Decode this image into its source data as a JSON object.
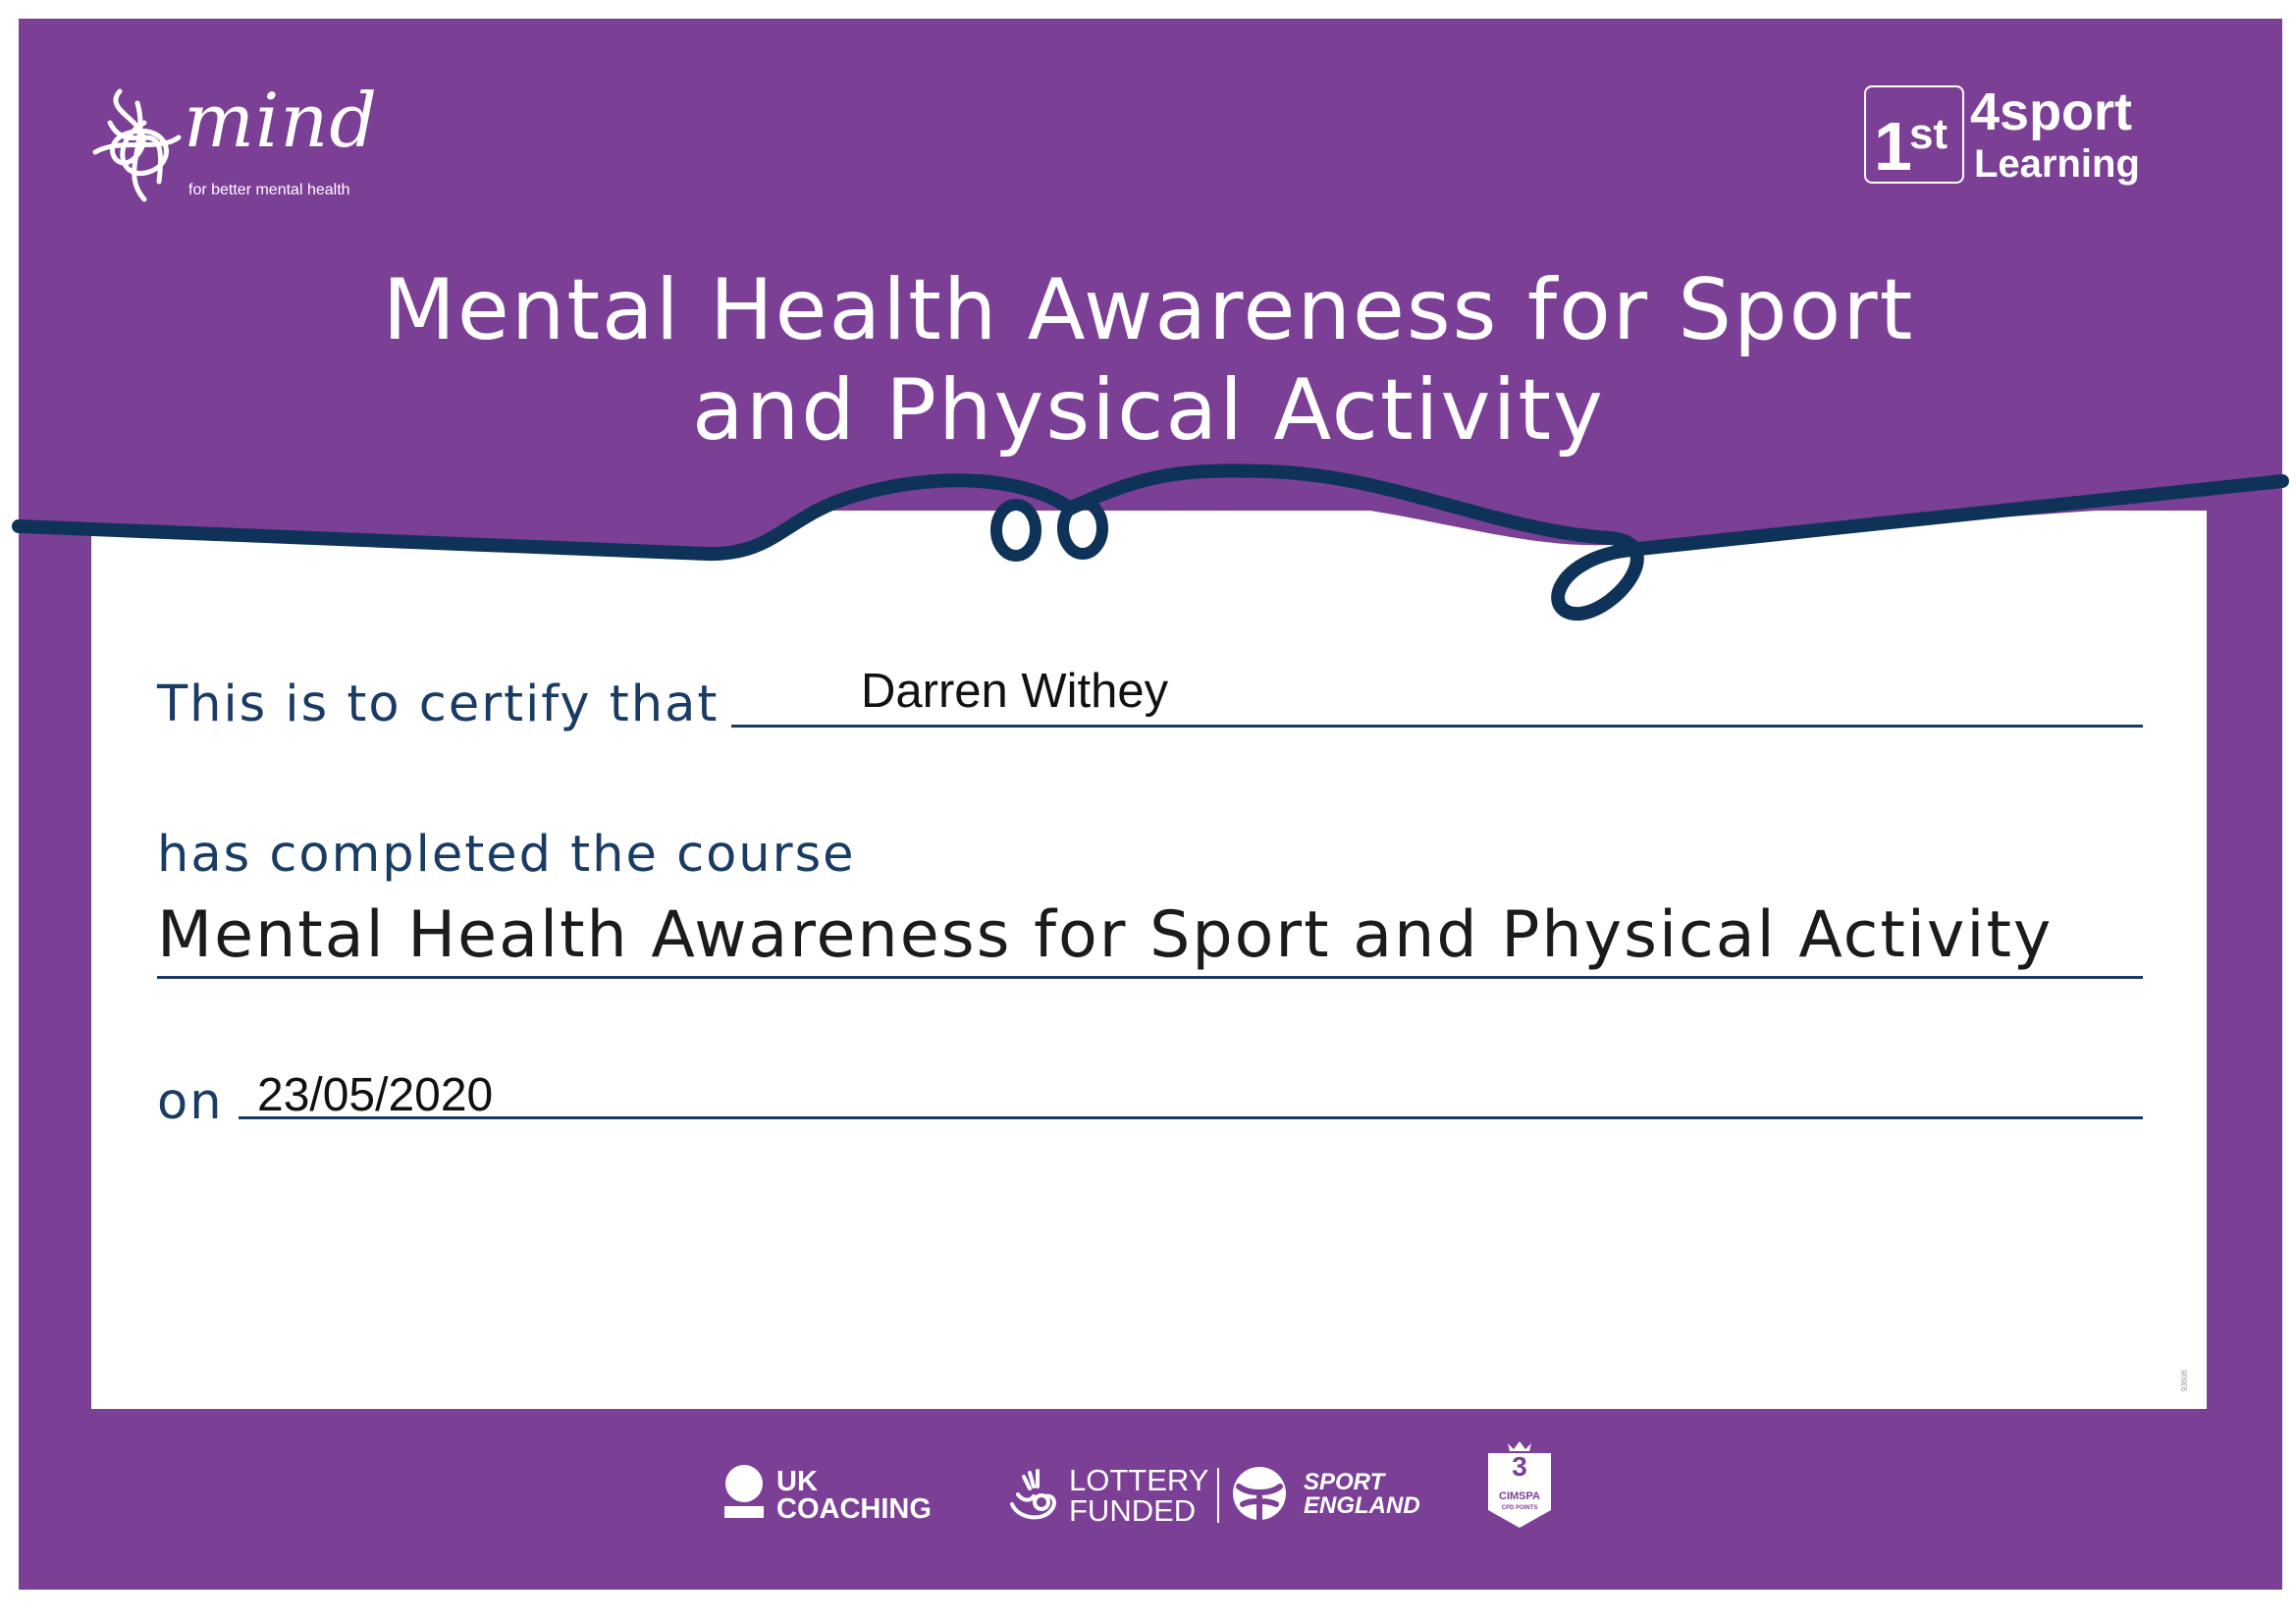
{
  "colors": {
    "frame": "#7b3f96",
    "accent_navy": "#0f3358",
    "text_navy": "#1a3b63",
    "panel": "#ffffff"
  },
  "header": {
    "mind_logo": {
      "icon": "mind-squiggle-icon",
      "wordmark": "mind",
      "tagline": "for better mental health"
    },
    "first4sport_logo": {
      "numeral": "1",
      "ordinal": "st",
      "line1": "4sport",
      "line2": "Learning"
    },
    "title_line1": "Mental Health Awareness for Sport",
    "title_line2": "and Physical Activity"
  },
  "certificate": {
    "certify_label": "This is to certify that",
    "recipient_name": "Darren Withey",
    "completed_label": "has completed the course",
    "course_name": "Mental Health Awareness for Sport and Physical Activity",
    "date_label": "on",
    "date_value": "23/05/2020",
    "reference_code": "93606"
  },
  "footer": {
    "uk_coaching": {
      "icon": "uk-coaching-icon",
      "line1": "UK",
      "line2": "COACHING"
    },
    "lottery": {
      "icon": "lottery-hands-icon",
      "line1": "LOTTERY",
      "line2": "FUNDED"
    },
    "sport_england": {
      "icon": "sport-england-icon",
      "line1": "SPORT",
      "line2": "ENGLAND"
    },
    "cimspa": {
      "icon": "cimspa-shield-icon",
      "points": "3",
      "name": "CIMSPA",
      "sub": "CPD POINTS"
    }
  }
}
